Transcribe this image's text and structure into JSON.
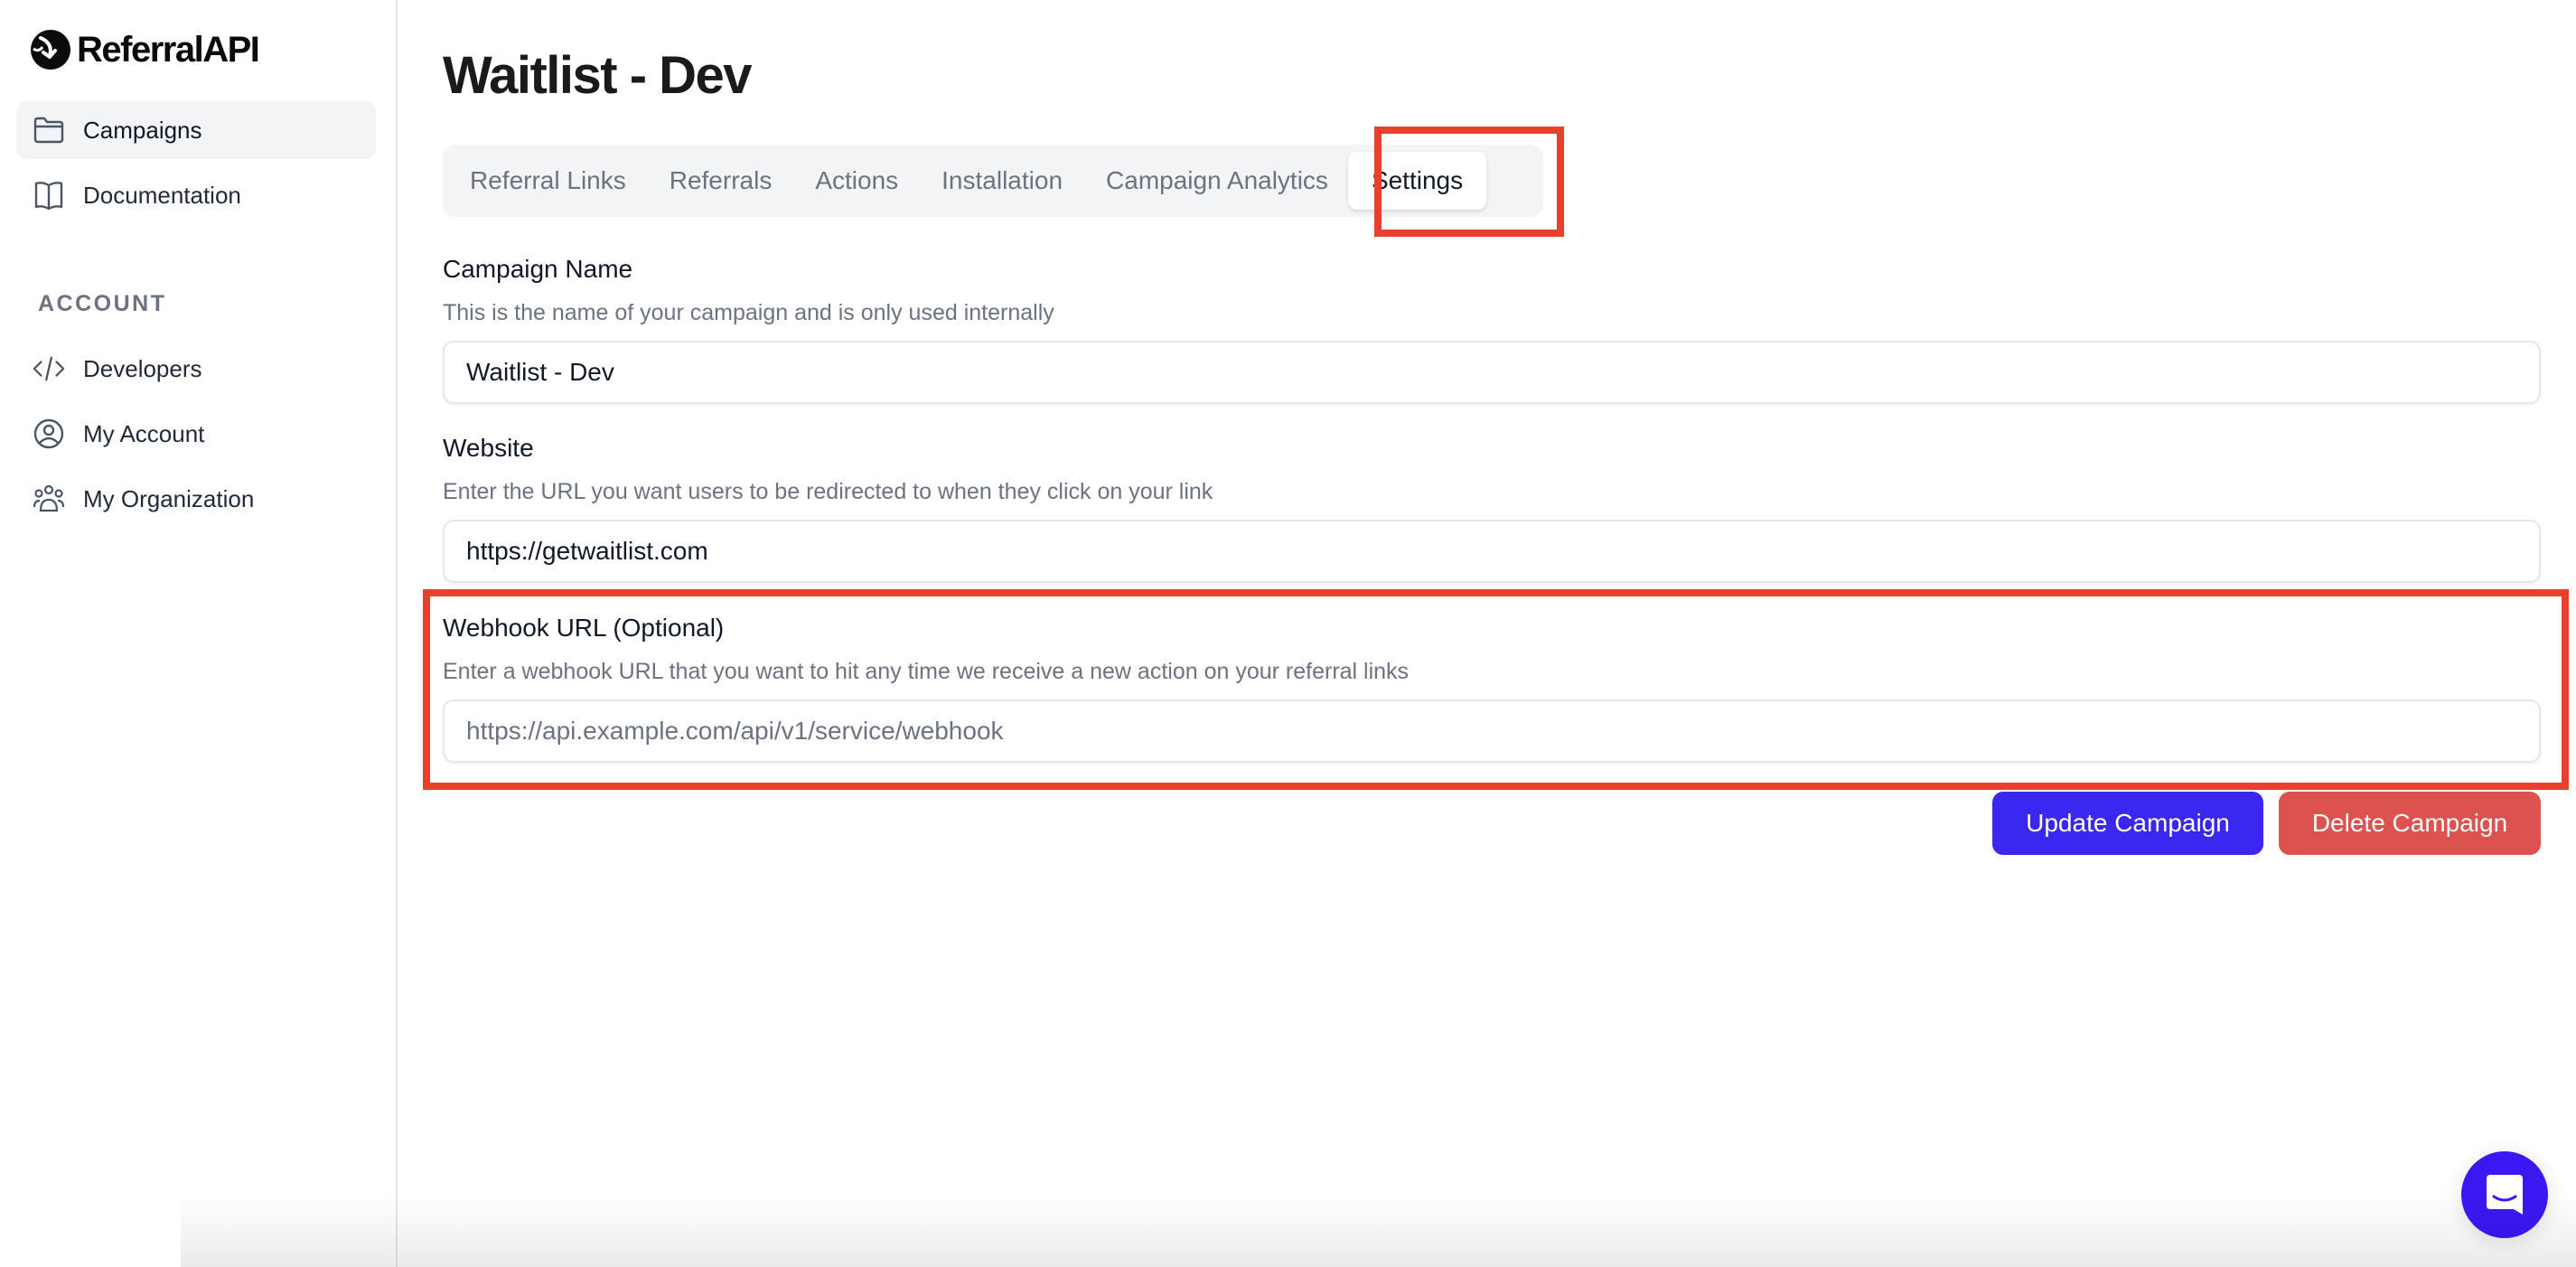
{
  "app": {
    "name": "ReferralAPI"
  },
  "sidebar": {
    "items": [
      {
        "label": "Campaigns",
        "icon": "folder-icon",
        "active": true
      },
      {
        "label": "Documentation",
        "icon": "book-icon",
        "active": false
      }
    ],
    "section_title": "ACCOUNT",
    "account_items": [
      {
        "label": "Developers",
        "icon": "code-icon"
      },
      {
        "label": "My Account",
        "icon": "user-circle-icon"
      },
      {
        "label": "My Organization",
        "icon": "users-group-icon"
      }
    ]
  },
  "page": {
    "title": "Waitlist - Dev"
  },
  "tabs": [
    {
      "label": "Referral Links",
      "active": false
    },
    {
      "label": "Referrals",
      "active": false
    },
    {
      "label": "Actions",
      "active": false
    },
    {
      "label": "Installation",
      "active": false
    },
    {
      "label": "Campaign Analytics",
      "active": false
    },
    {
      "label": "Settings",
      "active": true
    }
  ],
  "form": {
    "campaign_name": {
      "label": "Campaign Name",
      "description": "This is the name of your campaign and is only used internally",
      "value": "Waitlist - Dev",
      "placeholder": ""
    },
    "website": {
      "label": "Website",
      "description": "Enter the URL you want users to be redirected to when they click on your link",
      "value": "https://getwaitlist.com",
      "placeholder": ""
    },
    "webhook": {
      "label": "Webhook URL (Optional)",
      "description": "Enter a webhook URL that you want to hit any time we receive a new action on your referral links",
      "value": "",
      "placeholder": "https://api.example.com/api/v1/service/webhook"
    }
  },
  "actions": {
    "update_label": "Update Campaign",
    "delete_label": "Delete Campaign"
  },
  "colors": {
    "primary": "#3a28f0",
    "danger": "#dc524e",
    "highlight": "#e8412b",
    "chat": "#3b17f2"
  },
  "chat": {
    "icon": "chat-bubble-icon"
  }
}
